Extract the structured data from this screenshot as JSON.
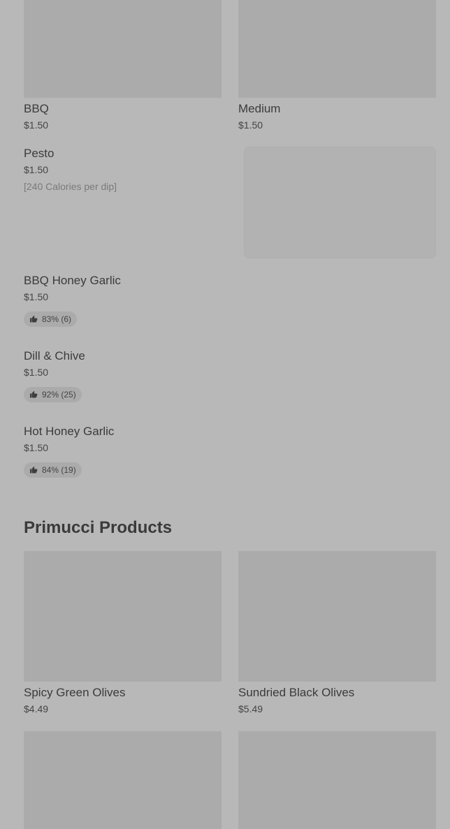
{
  "top_cards": [
    {
      "name": "BBQ",
      "price": "$1.50"
    },
    {
      "name": "Medium",
      "price": "$1.50"
    }
  ],
  "pesto": {
    "name": "Pesto",
    "price": "$1.50",
    "calories": "[240 Calories per dip]"
  },
  "list_items": [
    {
      "name": "BBQ Honey Garlic",
      "price": "$1.50",
      "rating": "83% (6)"
    },
    {
      "name": "Dill & Chive",
      "price": "$1.50",
      "rating": "92% (25)"
    },
    {
      "name": "Hot Honey Garlic",
      "price": "$1.50",
      "rating": "84% (19)"
    }
  ],
  "section_title": "Primucci Products",
  "products": [
    {
      "name": "Spicy Green Olives",
      "price": "$4.49"
    },
    {
      "name": "Sundried Black Olives",
      "price": "$5.49"
    }
  ]
}
